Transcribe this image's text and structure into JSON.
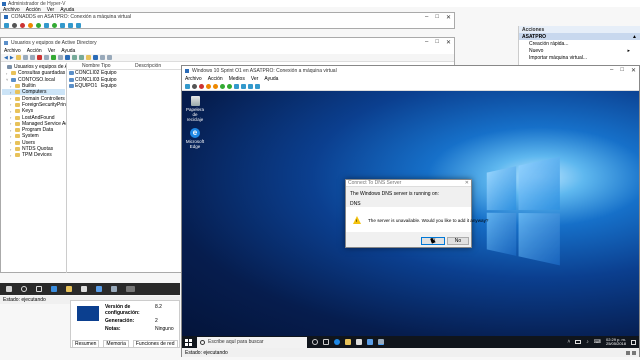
{
  "hyperv": {
    "title": "Administrador de Hyper-V",
    "menu": [
      "Archivo",
      "Acción",
      "Ver",
      "Ayuda"
    ],
    "status": "Estado: ejecutando",
    "details": {
      "config_label": "Versión de configuración:",
      "config_value": "8.2",
      "gen_label": "Generación:",
      "gen_value": "2",
      "notes_label": "Notas:",
      "notes_value": "Ninguno"
    },
    "tabs": [
      "Resumen",
      "Memoria",
      "Funciones de red"
    ]
  },
  "vm_small": {
    "title": "CONADDS en ASATPRO: Conexión a máquina virtual"
  },
  "aduc": {
    "title": "Usuarios y equipos de Active Directory",
    "menu": [
      "Archivo",
      "Acción",
      "Ver",
      "Ayuda"
    ],
    "tree": [
      {
        "label": "Usuarios y equipos de Active Directo",
        "level": 0,
        "icon": "root"
      },
      {
        "label": "Consultas guardadas",
        "level": 1,
        "icon": "folder"
      },
      {
        "label": "CONTOSO.local",
        "level": 1,
        "icon": "domain"
      },
      {
        "label": "Builtin",
        "level": 2,
        "icon": "folder"
      },
      {
        "label": "Computers",
        "level": 2,
        "icon": "folder",
        "selected": true
      },
      {
        "label": "Domain Controllers",
        "level": 2,
        "icon": "folder"
      },
      {
        "label": "ForeignSecurityPrincipal",
        "level": 2,
        "icon": "folder"
      },
      {
        "label": "Keys",
        "level": 2,
        "icon": "folder"
      },
      {
        "label": "LostAndFound",
        "level": 2,
        "icon": "folder"
      },
      {
        "label": "Managed Service Accou",
        "level": 2,
        "icon": "folder"
      },
      {
        "label": "Program Data",
        "level": 2,
        "icon": "folder"
      },
      {
        "label": "System",
        "level": 2,
        "icon": "folder"
      },
      {
        "label": "Users",
        "level": 2,
        "icon": "folder"
      },
      {
        "label": "NTDS Quotas",
        "level": 2,
        "icon": "folder"
      },
      {
        "label": "TPM Devices",
        "level": 2,
        "icon": "folder"
      }
    ],
    "columns": [
      "Nombre",
      "Tipo",
      "Descripción"
    ],
    "rows": [
      {
        "name": "CONCLI02",
        "type": "Equipo"
      },
      {
        "name": "CONCLI03",
        "type": "Equipo"
      },
      {
        "name": "EQUIPO1",
        "type": "Equipo"
      }
    ]
  },
  "actions": {
    "header": "Acciones",
    "target": "ASATPRO",
    "items": [
      "Creación rápida...",
      "Nuevo",
      "Importar máquina virtual..."
    ]
  },
  "vm_main": {
    "title": "Windows 10 Sprint O1 en ASATPRO: Conexión a máquina virtual",
    "menu": [
      "Archivo",
      "Acción",
      "Medios",
      "Ver",
      "Ayuda"
    ],
    "status": "Estado: ejecutando",
    "desktop_icons": [
      {
        "label": "Papelera de reciclaje",
        "icon": "recycle-bin-icon"
      },
      {
        "label": "Microsoft Edge",
        "icon": "edge-icon"
      }
    ],
    "search_placeholder": "Escribe aquí para buscar",
    "clock_time": "02:29 p. m.",
    "clock_date": "25/05/2018"
  },
  "dialog": {
    "title": "Connect To DNS Server",
    "intro": "The Windows DNS server is running on:",
    "server": "DNS",
    "message": "The server is unavailable. Would you like to add it anyway?",
    "yes": "Sí",
    "no": "No"
  },
  "colors": {
    "accent": "#0078d7",
    "taskbar": "#1e2530",
    "folder": "#e8c25a"
  }
}
